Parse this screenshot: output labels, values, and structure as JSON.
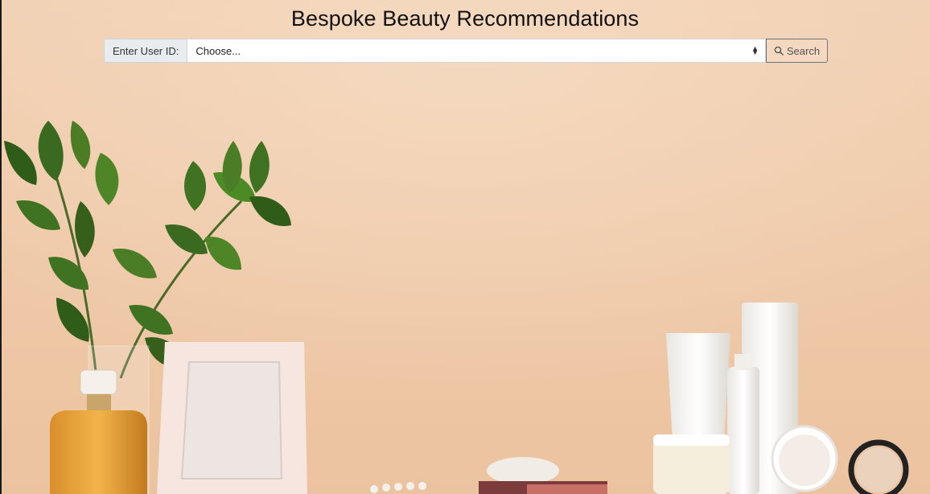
{
  "page": {
    "title": "Bespoke Beauty Recommendations"
  },
  "search": {
    "label": "Enter User ID:",
    "select_value": "Choose...",
    "button_label": "Search"
  },
  "icons": {
    "search": "search-icon",
    "select": "select-arrows-icon"
  },
  "colors": {
    "wall": "#f0cfb0",
    "title": "#111111",
    "button_border": "#6c757d"
  }
}
